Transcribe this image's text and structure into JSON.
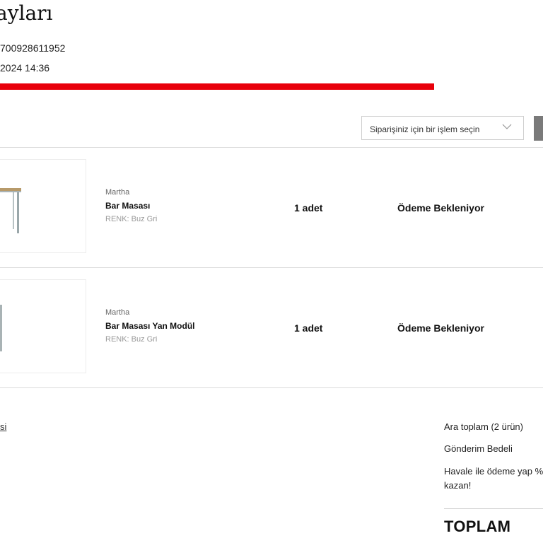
{
  "header": {
    "title": "ayları",
    "order_number": "700928611952",
    "order_date": "2024 14:36"
  },
  "actions": {
    "select_placeholder": "Siparişiniz için bir işlem seçin"
  },
  "items": [
    {
      "brand": "Martha",
      "name": "Bar Masası",
      "color": "RENK: Buz Gri",
      "qty": "1 adet",
      "status": "Ödeme Bekleniyor"
    },
    {
      "brand": "Martha",
      "name": "Bar Masası Yan Modül",
      "color": "RENK: Buz Gri",
      "qty": "1 adet",
      "status": "Ödeme Bekleniyor"
    }
  ],
  "footer": {
    "link_fragment": "si"
  },
  "summary": {
    "subtotal_label": "Ara toplam (2 ürün)",
    "shipping_label": "Gönderim Bedeli",
    "transfer_label_line1": "Havale ile ödeme yap %",
    "transfer_label_line2": "kazan!",
    "total_label": "TOPLAM"
  },
  "colors": {
    "redaction": "#e8000b",
    "divider": "#dcdcdc",
    "button_gray": "#7a7a7a"
  }
}
